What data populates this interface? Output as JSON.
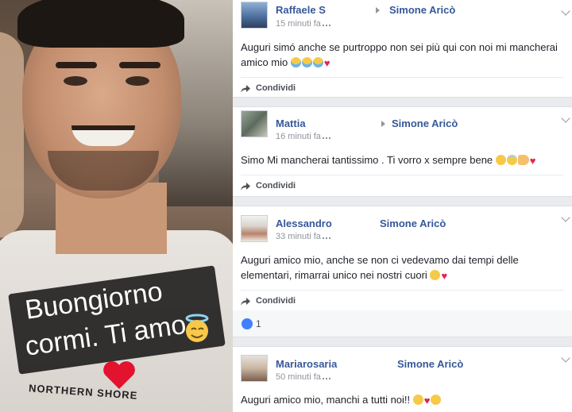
{
  "photo": {
    "caption_line1": "Buongiorno",
    "caption_line2": "cormi. Ti amo",
    "shirt_text": "NORTHERN SHORE",
    "icons": [
      "angel-face-icon",
      "red-heart-icon"
    ]
  },
  "share_label": "Condividi",
  "comments": [
    {
      "author": "Raffaele S",
      "target": "Simone Aricò",
      "time": "15 minuti fa",
      "text": "Auguri simó anche se purtroppo non sei più qui con noi mi mancherai amico mio",
      "emoji": [
        "crying-face-icon",
        "crying-face-icon",
        "crying-face-icon",
        "red-heart-icon"
      ]
    },
    {
      "author": "Mattia",
      "target": "Simone Aricò",
      "time": "16 minuti fa",
      "text": "Simo Mi mancherai tantissimo . Ti vorro x sempre bene",
      "emoji": [
        "sad-face-icon",
        "halo-face-icon",
        "pointing-hand-icon",
        "red-heart-icon"
      ]
    },
    {
      "author": "Alessandro",
      "target": "Simone Aricò",
      "time": "33 minuti fa",
      "text": "Auguri amico mio, anche se non ci vedevamo dai tempi delle elementari, rimarrai unico nei nostri cuori",
      "emoji": [
        "sad-face-icon",
        "red-heart-icon"
      ],
      "likes": "1"
    },
    {
      "author": "Mariarosaria",
      "target": "Simone Aricò",
      "time": "50 minuti fa",
      "text": "Auguri amico mio, manchi a tutti noi!!",
      "emoji": [
        "relieved-face-icon",
        "broken-heart-icon",
        "sad-face-icon"
      ]
    }
  ],
  "colors": {
    "link": "#365899",
    "meta": "#90949c",
    "text": "#1d2129",
    "feed_bg": "#e9ebee",
    "like_blue": "#4080ff",
    "heart": "#e0245e"
  }
}
